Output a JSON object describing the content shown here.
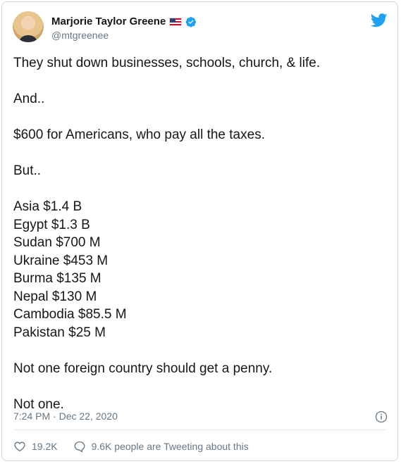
{
  "author": {
    "name": "Marjorie Taylor Greene",
    "handle": "@mtgreenee",
    "flag_icon": "us-flag-icon",
    "verified_icon": "verified-badge-icon"
  },
  "platform_icon": "twitter-bird-icon",
  "tweet": {
    "lines": [
      "They shut down businesses, schools, church, & life.",
      "",
      "And..",
      "",
      "$600 for Americans, who pay all the taxes.",
      "",
      "But..",
      "",
      "Asia $1.4 B",
      "Egypt $1.3 B",
      "Sudan $700 M",
      "Ukraine $453 M",
      "Burma $135 M",
      "Nepal $130 M",
      "Cambodia $85.5 M",
      "Pakistan $25 M",
      "",
      "Not one foreign country should get a penny.",
      "",
      "Not one."
    ]
  },
  "timestamp": "7:24 PM · Dec 22, 2020",
  "likes": "19.2K",
  "conversation": "9.6K people are Tweeting about this",
  "colors": {
    "twitter_blue": "#1da1f2",
    "text": "#14171a",
    "secondary": "#657786"
  }
}
